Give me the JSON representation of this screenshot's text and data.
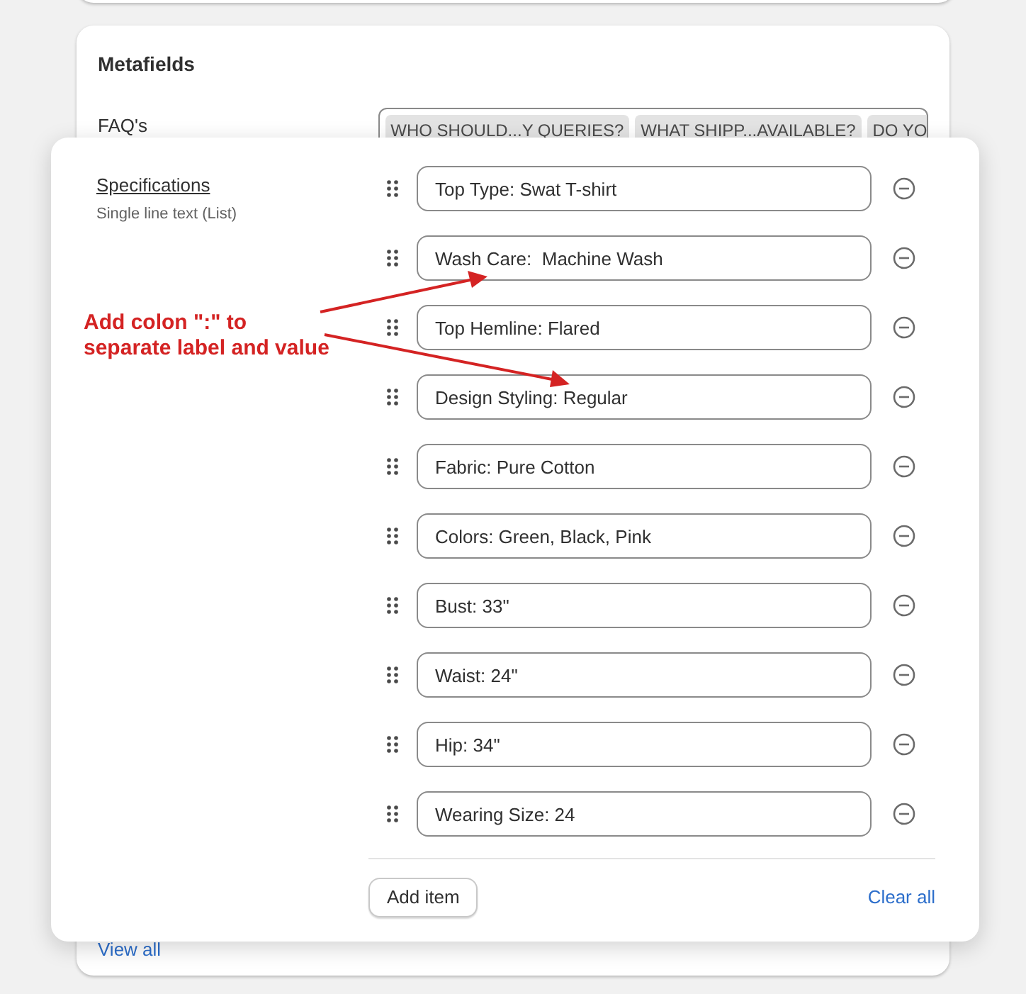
{
  "card": {
    "title": "Metafields",
    "faq": {
      "label": "FAQ's",
      "chips": [
        "WHO SHOULD...Y QUERIES?",
        "WHAT SHIPP...AVAILABLE?",
        "DO YO"
      ]
    },
    "view_all": "View all"
  },
  "popover": {
    "field_label": "Specifications",
    "field_type": "Single line text (List)",
    "items": [
      {
        "value": "Top Type: Swat T-shirt"
      },
      {
        "value": "Wash Care:  Machine Wash"
      },
      {
        "value": "Top Hemline: Flared"
      },
      {
        "value": "Design Styling: Regular"
      },
      {
        "value": "Fabric: Pure Cotton"
      },
      {
        "value": "Colors: Green, Black, Pink"
      },
      {
        "value": "Bust: 33\""
      },
      {
        "value": "Waist: 24\""
      },
      {
        "value": "Hip: 34\""
      },
      {
        "value": "Wearing Size: 24"
      }
    ],
    "add_button": "Add item",
    "clear_link": "Clear all"
  },
  "annotation": {
    "lines": [
      "Add colon \":\" to",
      "separate label and value"
    ]
  }
}
